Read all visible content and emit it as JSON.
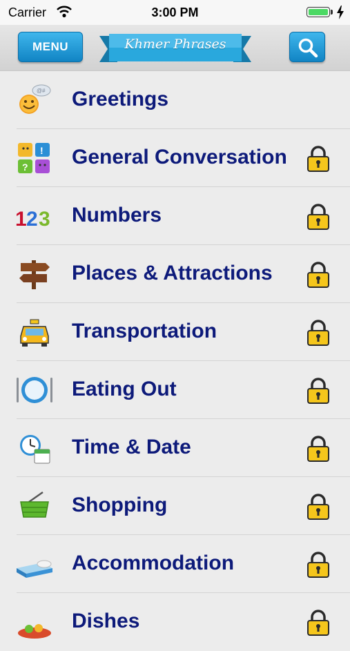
{
  "status_bar": {
    "carrier": "Carrier",
    "time": "3:00 PM",
    "battery_level": 1.0
  },
  "nav": {
    "menu_label": "MENU",
    "title": "Khmer Phrases",
    "accent_color": "#1f9bd7"
  },
  "categories": [
    {
      "label": "Greetings",
      "icon": "smiley-speech-icon",
      "locked": false
    },
    {
      "label": "General Conversation",
      "icon": "colorful-blocks-icon",
      "locked": true
    },
    {
      "label": "Numbers",
      "icon": "numbers-123-icon",
      "locked": true
    },
    {
      "label": "Places & Attractions",
      "icon": "signpost-icon",
      "locked": true
    },
    {
      "label": "Transportation",
      "icon": "taxi-icon",
      "locked": true
    },
    {
      "label": "Eating Out",
      "icon": "plate-cutlery-icon",
      "locked": true
    },
    {
      "label": "Time & Date",
      "icon": "clock-calendar-icon",
      "locked": true
    },
    {
      "label": "Shopping",
      "icon": "shopping-basket-icon",
      "locked": true
    },
    {
      "label": "Accommodation",
      "icon": "bed-icon",
      "locked": true
    },
    {
      "label": "Dishes",
      "icon": "dish-icon",
      "locked": true
    }
  ]
}
